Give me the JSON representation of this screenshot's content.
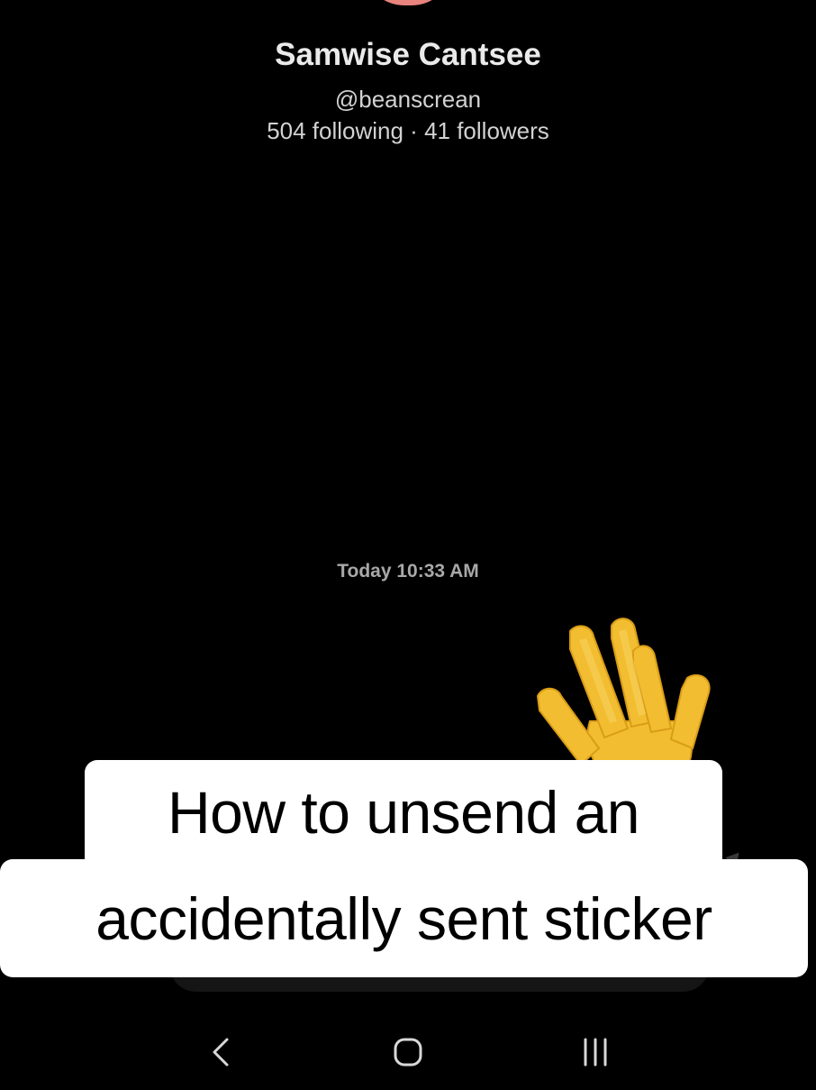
{
  "profile": {
    "name": "Samwise Cantsee",
    "handle": "@beanscrean",
    "stats": "504 following · 41 followers"
  },
  "conversation": {
    "timestamp": "Today 10:33 AM",
    "sticker": {
      "icon": "waving-hand-icon",
      "color": "#f5c53a"
    }
  },
  "caption": {
    "line1": "How to unsend an",
    "line2": "accidentally sent sticker"
  },
  "nav": {
    "back_icon": "back-icon",
    "home_icon": "home-icon",
    "recents_icon": "recents-icon"
  },
  "colors": {
    "background": "#000000",
    "avatar": "#e8837e",
    "caption_bg": "#ffffff"
  }
}
